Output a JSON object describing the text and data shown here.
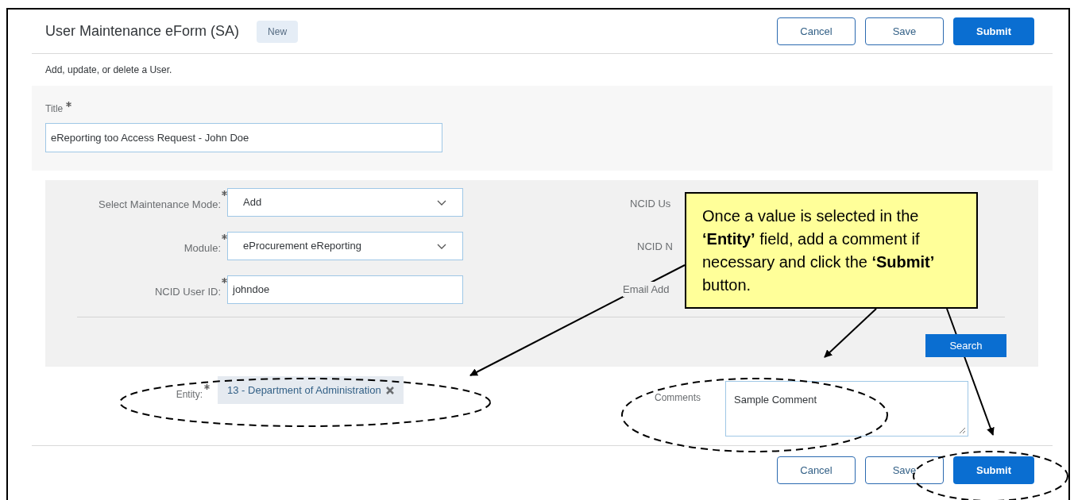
{
  "header": {
    "title": "User Maintenance eForm (SA)",
    "badge": "New",
    "buttons": [
      {
        "label": "Cancel",
        "kind": "secondary"
      },
      {
        "label": "Save",
        "kind": "secondary"
      },
      {
        "label": "Submit",
        "kind": "primary"
      }
    ]
  },
  "description": "Add, update, or delete a User.",
  "title_field": {
    "label": "Title",
    "required": true,
    "value": "eReporting too Access Request - John Doe"
  },
  "maintenance": {
    "fields": [
      {
        "label": "Select Maintenance Mode:",
        "required": true,
        "kind": "select",
        "value": "Add"
      },
      {
        "label": "Module:",
        "required": true,
        "kind": "select",
        "value": "eProcurement eReporting"
      },
      {
        "label": "NCID User ID:",
        "required": true,
        "kind": "text",
        "value": "johndoe"
      }
    ],
    "right_labels": [
      "NCID Us",
      "NCID N",
      "Email Add"
    ],
    "search_button": "Search"
  },
  "entity": {
    "label": "Entity:",
    "required": true,
    "token": "13 - Department of Administration"
  },
  "comments": {
    "label": "Comments",
    "value": "Sample Comment"
  },
  "footer": {
    "buttons": [
      {
        "label": "Cancel",
        "kind": "secondary"
      },
      {
        "label": "Save",
        "kind": "secondary"
      },
      {
        "label": "Submit",
        "kind": "primary"
      }
    ]
  },
  "callout": {
    "text": "Once a value is selected in the **‘Entity’** field, add a comment if necessary and click the **‘Submit’** button."
  }
}
